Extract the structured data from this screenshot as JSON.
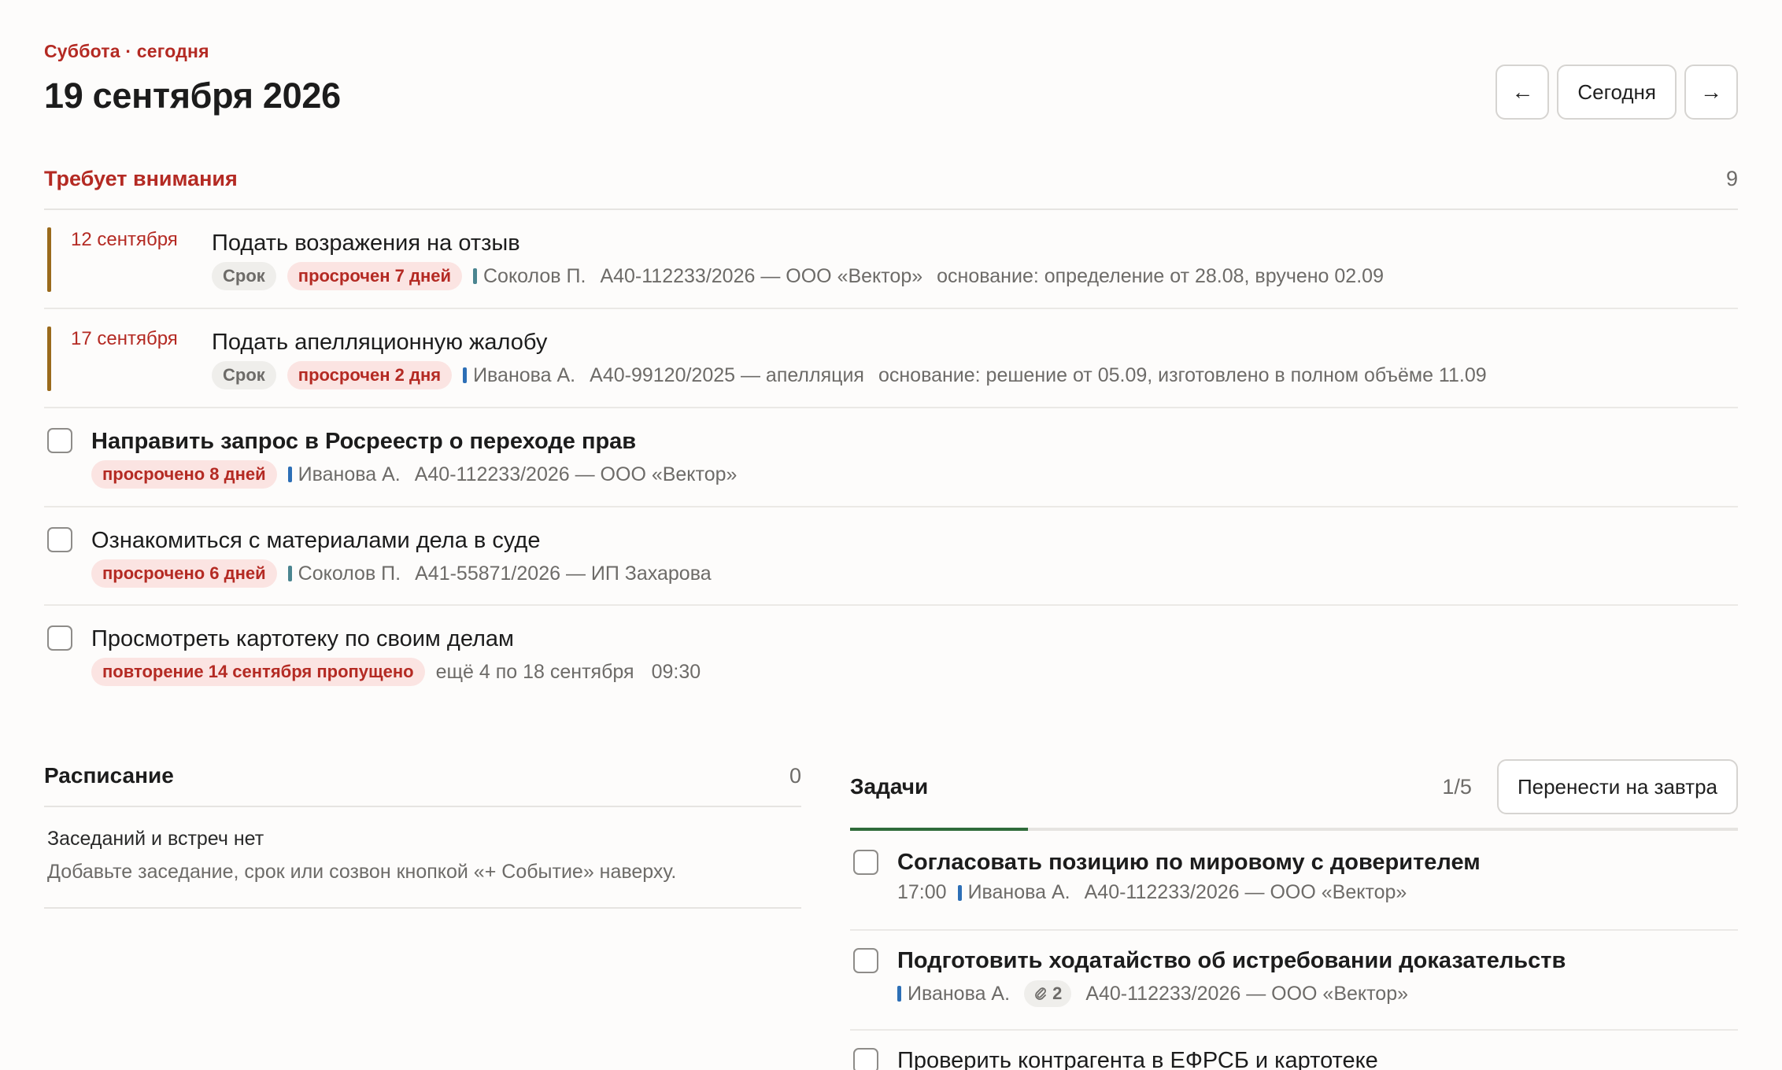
{
  "header": {
    "eyebrow": "Суббота · сегодня",
    "date": "19 сентября 2026",
    "prev_icon": "←",
    "today_label": "Сегодня",
    "next_icon": "→"
  },
  "attention": {
    "title": "Требует внимания",
    "count": "9",
    "deadlines": [
      {
        "date": "12 сентября",
        "title": "Подать возражения на отзыв",
        "kind": "Срок",
        "status": "просрочен 7 дней",
        "assignee": "Соколов П.",
        "case": "А40-112233/2026 — ООО «Вектор»",
        "basis": "основание: определение от 28.08, вручено 02.09"
      },
      {
        "date": "17 сентября",
        "title": "Подать апелляционную жалобу",
        "kind": "Срок",
        "status": "просрочен 2 дня",
        "assignee": "Иванова А.",
        "case": "А40-99120/2025 — апелляция",
        "basis": "основание: решение от 05.09, изготовлено в полном объёме 11.09"
      }
    ],
    "tasks": [
      {
        "title": "Направить запрос в Росреестр о переходе прав",
        "status": "просрочено 8 дней",
        "assignee": "Иванова А.",
        "case": "А40-112233/2026 — ООО «Вектор»"
      },
      {
        "title": "Ознакомиться с материалами дела в суде",
        "status": "просрочено 6 дней",
        "assignee": "Соколов П.",
        "case": "А41-55871/2026 — ИП Захарова"
      },
      {
        "title": "Просмотреть картотеку по своим делам",
        "status": "повторение 14 сентября пропущено",
        "more": "ещё 4 по 18 сентября",
        "time": "09:30"
      }
    ]
  },
  "schedule": {
    "title": "Расписание",
    "count": "0",
    "empty_title": "Заседаний и встреч нет",
    "empty_hint": "Добавьте заседание, срок или созвон кнопкой «+ Событие» наверху."
  },
  "tasks": {
    "title": "Задачи",
    "count": "1/5",
    "progress": 0.2,
    "move_label": "Перенести на завтра",
    "items": [
      {
        "title": "Согласовать позицию по мировому с доверителем",
        "time": "17:00",
        "assignee": "Иванова А.",
        "case": "А40-112233/2026 — ООО «Вектор»"
      },
      {
        "title": "Подготовить ходатайство об истребовании доказательств",
        "assignee": "Иванова А.",
        "attachments": "2",
        "case": "А40-112233/2026 — ООО «Вектор»"
      },
      {
        "title": "Проверить контрагента в ЕФРСБ и картотеке"
      }
    ]
  },
  "colors": {
    "accent_red": "#b42a23",
    "deadline_bar": "#9a6a1c",
    "progress_green": "#2f6b3a"
  }
}
